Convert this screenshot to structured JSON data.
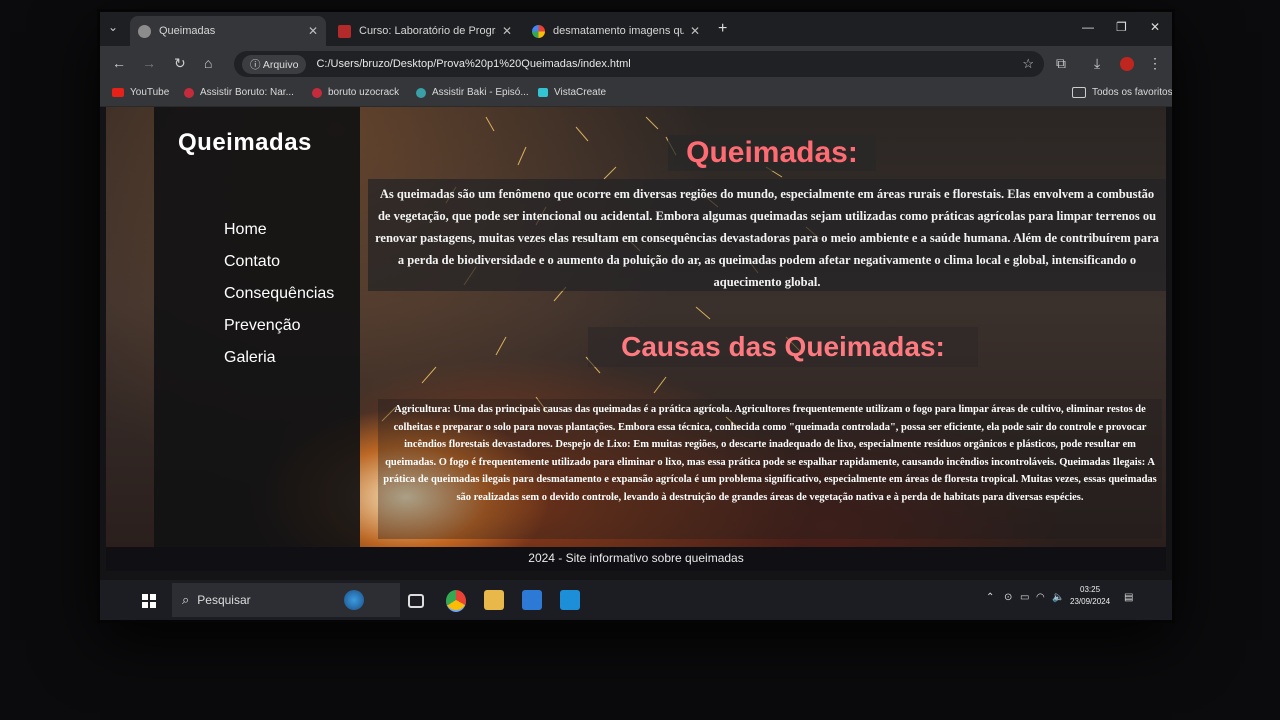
{
  "browser": {
    "tabs": [
      {
        "title": "Queimadas",
        "active": true
      },
      {
        "title": "Curso: Laboratório de Programa",
        "active": false
      },
      {
        "title": "desmatamento imagens queim",
        "active": false
      }
    ],
    "address": {
      "chip": "Arquivo",
      "url": "C:/Users/bruzo/Desktop/Prova%20p1%20Queimadas/index.html"
    },
    "bookmarks": [
      "YouTube",
      "Assistir Boruto: Nar...",
      "boruto uzocrack",
      "Assistir Baki - Episó...",
      "VistaCreate"
    ],
    "all_bookmarks": "Todos os favoritos"
  },
  "site": {
    "brand": "Queimadas",
    "nav": [
      "Home",
      "Contato",
      "Consequências",
      "Prevenção",
      "Galeria"
    ],
    "heading": "Queimadas:",
    "intro": "As queimadas são um fenômeno que ocorre em diversas regiões do mundo, especialmente em áreas rurais e florestais. Elas envolvem a combustão de vegetação, que pode ser intencional ou acidental. Embora algumas queimadas sejam utilizadas como práticas agrícolas para limpar terrenos ou renovar pastagens, muitas vezes elas resultam em consequências devastadoras para o meio ambiente e a saúde humana. Além de contribuírem para a perda de biodiversidade e o aumento da poluição do ar, as queimadas podem afetar negativamente o clima local e global, intensificando o aquecimento global.",
    "heading2": "Causas das Queimadas:",
    "causes": "Agricultura: Uma das principais causas das queimadas é a prática agrícola. Agricultores frequentemente utilizam o fogo para limpar áreas de cultivo, eliminar restos de colheitas e preparar o solo para novas plantações. Embora essa técnica, conhecida como \"queimada controlada\", possa ser eficiente, ela pode sair do controle e provocar incêndios florestais devastadores. Despejo de Lixo: Em muitas regiões, o descarte inadequado de lixo, especialmente resíduos orgânicos e plásticos, pode resultar em queimadas. O fogo é frequentemente utilizado para eliminar o lixo, mas essa prática pode se espalhar rapidamente, causando incêndios incontroláveis. Queimadas Ilegais: A prática de queimadas ilegais para desmatamento e expansão agrícola é um problema significativo, especialmente em áreas de floresta tropical. Muitas vezes, essas queimadas são realizadas sem o devido controle, levando à destruição de grandes áreas de vegetação nativa e à perda de habitats para diversas espécies.",
    "footer": "2024 - Site informativo sobre queimadas"
  },
  "taskbar": {
    "search_placeholder": "Pesquisar",
    "time": "03:25",
    "date": "23/09/2024"
  },
  "colors": {
    "heading": "#ff6b73",
    "chrome_dark": "#1e1f22",
    "toolbar": "#35363a"
  }
}
